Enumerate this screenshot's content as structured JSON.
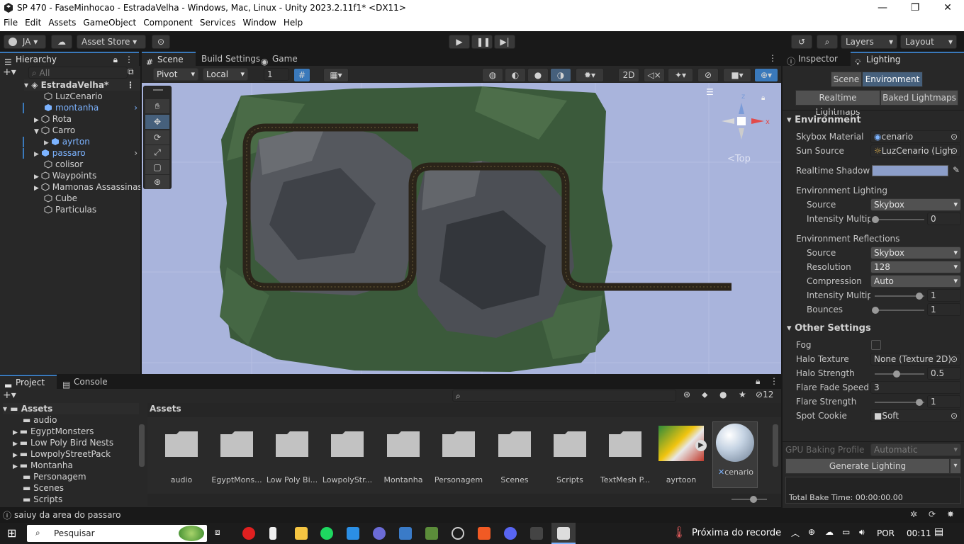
{
  "window": {
    "title": "SP 470 - FaseMinhocao - EstradaVelha - Windows, Mac, Linux - Unity 2023.2.11f1* <DX11>"
  },
  "menu": [
    "File",
    "Edit",
    "Assets",
    "GameObject",
    "Component",
    "Services",
    "Window",
    "Help"
  ],
  "toolbar": {
    "account": "JA",
    "asset_store": "Asset Store",
    "layers": "Layers",
    "layout": "Layout"
  },
  "hierarchy": {
    "tab": "Hierarchy",
    "search_placeholder": "All",
    "scene": "EstradaVelha*",
    "items": [
      {
        "label": "LuzCenario"
      },
      {
        "label": "montanha"
      },
      {
        "label": "Rota"
      },
      {
        "label": "Carro"
      },
      {
        "label": "ayrton"
      },
      {
        "label": "passaro"
      },
      {
        "label": "colisor"
      },
      {
        "label": "Waypoints"
      },
      {
        "label": "Mamonas Assassinas"
      },
      {
        "label": "Cube"
      },
      {
        "label": "Particulas"
      }
    ]
  },
  "scene_tabs": {
    "scene": "Scene",
    "build": "Build Settings",
    "game": "Game"
  },
  "scene_toolbar": {
    "pivot": "Pivot",
    "local": "Local",
    "snap": "1",
    "mode2d": "2D",
    "gizmo_label": "Top"
  },
  "inspector": {
    "tab_inspector": "Inspector",
    "tab_lighting": "Lighting",
    "seg_scene": "Scene",
    "seg_environment": "Environment",
    "realtime_lightmaps": "Realtime Lightmaps",
    "baked_lightmaps": "Baked Lightmaps",
    "environment_header": "Environment",
    "skybox_material_label": "Skybox Material",
    "skybox_material_value": "cenario",
    "sun_source_label": "Sun Source",
    "sun_source_value": "LuzCenario (Ligh",
    "realtime_shadow_label": "Realtime Shadow C",
    "env_lighting_header": "Environment Lighting",
    "source_label": "Source",
    "source_value": "Skybox",
    "intensity_label": "Intensity Multipl",
    "intensity_value": "0",
    "env_reflections_header": "Environment Reflections",
    "refl_source_label": "Source",
    "refl_source_value": "Skybox",
    "resolution_label": "Resolution",
    "resolution_value": "128",
    "compression_label": "Compression",
    "compression_value": "Auto",
    "refl_intensity_label": "Intensity Multipl",
    "refl_intensity_value": "1",
    "bounces_label": "Bounces",
    "bounces_value": "1",
    "other_header": "Other Settings",
    "fog_label": "Fog",
    "halo_texture_label": "Halo Texture",
    "halo_texture_value": "None (Texture 2D)",
    "halo_strength_label": "Halo Strength",
    "halo_strength_value": "0.5",
    "flare_fade_label": "Flare Fade Speed",
    "flare_fade_value": "3",
    "flare_strength_label": "Flare Strength",
    "flare_strength_value": "1",
    "spot_cookie_label": "Spot Cookie",
    "spot_cookie_value": "Soft",
    "gpu_profile_label": "GPU Baking Profile",
    "gpu_profile_value": "Automatic",
    "generate_lighting": "Generate Lighting",
    "bake_time": "Total Bake Time: 00:00:00.00"
  },
  "project": {
    "tab_project": "Project",
    "tab_console": "Console",
    "hidden_count": "12",
    "tree_root": "Assets",
    "tree": [
      {
        "label": "audio"
      },
      {
        "label": "EgyptMonsters"
      },
      {
        "label": "Low Poly Bird Nests"
      },
      {
        "label": "LowpolyStreetPack"
      },
      {
        "label": "Montanha"
      },
      {
        "label": "Personagem"
      },
      {
        "label": "Scenes"
      },
      {
        "label": "Scripts"
      }
    ],
    "breadcrumb": "Assets",
    "assets": [
      {
        "label": "audio"
      },
      {
        "label": "EgyptMons..."
      },
      {
        "label": "Low Poly Bi..."
      },
      {
        "label": "LowpolyStr..."
      },
      {
        "label": "Montanha"
      },
      {
        "label": "Personagem"
      },
      {
        "label": "Scenes"
      },
      {
        "label": "Scripts"
      },
      {
        "label": "TextMesh P..."
      },
      {
        "label": "ayrtoon"
      },
      {
        "label": "cenario"
      }
    ]
  },
  "status": {
    "message": "saiuy da area do passaro"
  },
  "taskbar": {
    "search": "Pesquisar",
    "notify": "Próxima do recorde",
    "lang": "POR",
    "time": "00:11"
  },
  "colors": {
    "accent": "#3a79bb",
    "terrain": "#3b5a3b",
    "road": "#2b2419",
    "sky": "#a9b4dc"
  }
}
